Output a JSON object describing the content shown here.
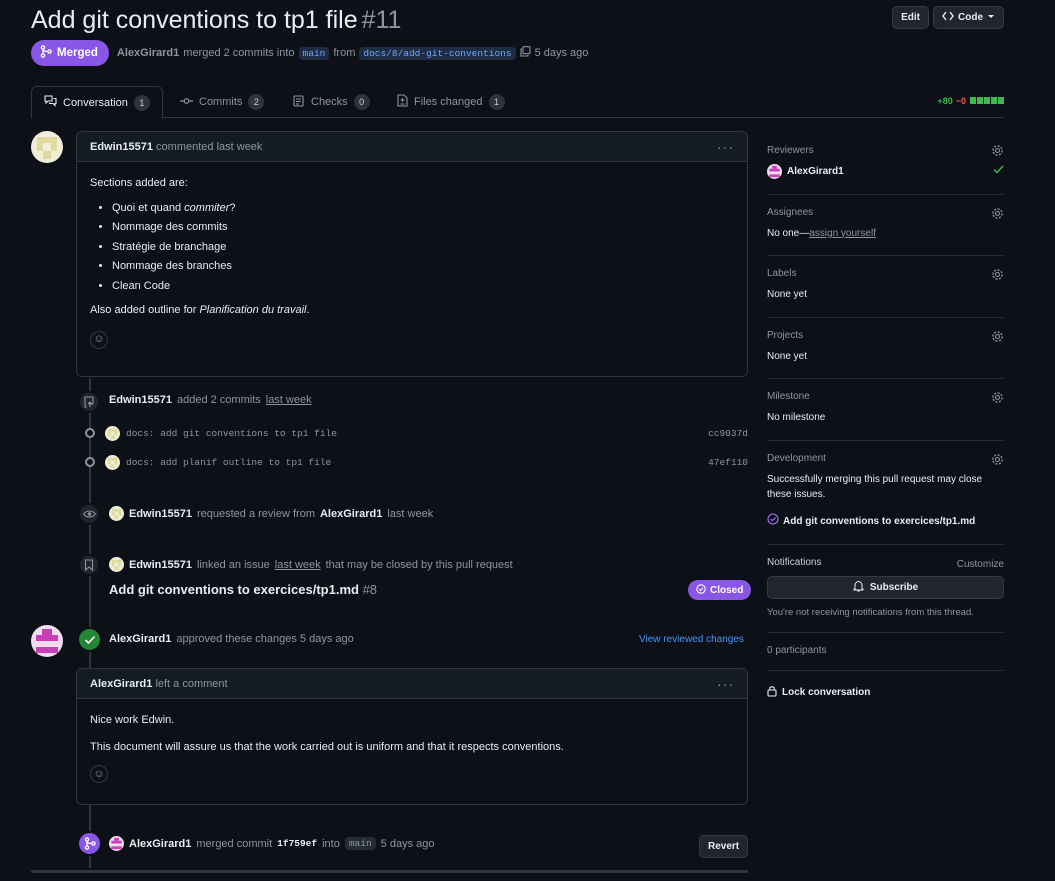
{
  "header": {
    "title": "Add git conventions to tp1 file",
    "number": "#11",
    "edit_label": "Edit",
    "code_label": "Code"
  },
  "state": {
    "badge": "Merged",
    "author": "AlexGirard1",
    "merged_text": "merged 2 commits into",
    "base_branch": "main",
    "from_text": "from",
    "head_branch": "docs/8/add-git-conventions",
    "time": "5 days ago"
  },
  "tabs": [
    {
      "label": "Conversation",
      "count": "1"
    },
    {
      "label": "Commits",
      "count": "2"
    },
    {
      "label": "Checks",
      "count": "0"
    },
    {
      "label": "Files changed",
      "count": "1"
    }
  ],
  "diffstat": {
    "additions": "+80",
    "deletions": "−0"
  },
  "comment1": {
    "author": "Edwin15571",
    "action": "commented last week",
    "intro": "Sections added are:",
    "item1_pre": "Quoi et quand ",
    "item1_em": "commiter",
    "item1_post": "?",
    "items": [
      "Nommage des commits",
      "Stratégie de branchage",
      "Nommage des branches",
      "Clean Code"
    ],
    "outro_pre": "Also added outline for ",
    "outro_em": "Planification du travail",
    "outro_post": "."
  },
  "commits_event": {
    "author": "Edwin15571",
    "action": "added 2 commits",
    "time": "last week",
    "commits": [
      {
        "message": "docs: add git conventions to tp1 file",
        "sha": "cc9037d"
      },
      {
        "message": "docs: add planif outline to tp1 file",
        "sha": "47ef110"
      }
    ]
  },
  "review_request": {
    "author": "Edwin15571",
    "action": "requested a review from",
    "reviewer": "AlexGirard1",
    "time": "last week"
  },
  "linked_issue": {
    "author": "Edwin15571",
    "action_pre": "linked an issue",
    "time": "last week",
    "action_post": "that may be closed by this pull request",
    "issue_title": "Add git conventions to exercices/tp1.md",
    "issue_number": "#8",
    "status": "Closed"
  },
  "approval": {
    "author": "AlexGirard1",
    "action": "approved these changes 5 days ago",
    "view_link": "View reviewed changes"
  },
  "comment2": {
    "author": "AlexGirard1",
    "action": "left a comment",
    "line1": "Nice work Edwin.",
    "line2": "This document will assure us that the work carried out is uniform and that it respects conventions."
  },
  "merge_event": {
    "author": "AlexGirard1",
    "action": "merged commit",
    "sha": "1f759ef",
    "into": "into",
    "branch": "main",
    "time": "5 days ago",
    "revert_label": "Revert"
  },
  "sidebar": {
    "reviewers_title": "Reviewers",
    "reviewer": "AlexGirard1",
    "assignees_title": "Assignees",
    "assignees_none": "No one—",
    "assign_yourself": "assign yourself",
    "labels_title": "Labels",
    "labels_value": "None yet",
    "projects_title": "Projects",
    "projects_value": "None yet",
    "milestone_title": "Milestone",
    "milestone_value": "No milestone",
    "development_title": "Development",
    "development_text": "Successfully merging this pull request may close these issues.",
    "development_issue": "Add git conventions to exercices/tp1.md",
    "notifications_title": "Notifications",
    "customize": "Customize",
    "subscribe": "Subscribe",
    "notif_text": "You're not receiving notifications from this thread.",
    "participants": "0 participants",
    "lock": "Lock conversation"
  },
  "colors": {
    "merged": "#8957e5",
    "link": "#4493f8",
    "approved": "#238636",
    "add": "#3fb950",
    "del": "#f85149"
  }
}
